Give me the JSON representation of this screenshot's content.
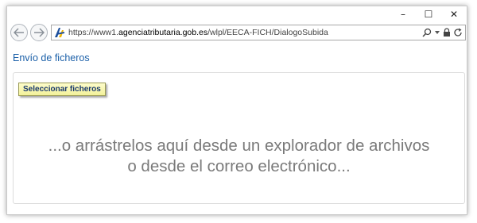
{
  "window": {
    "controls": {
      "minimize": "–",
      "maximize": "☐",
      "close": "✕"
    }
  },
  "addressbar": {
    "url_prefix": "https://www1.",
    "url_domain": "agenciatributaria.gob.es",
    "url_path": "/wlpl/EECA-FICH/DialogoSubida",
    "search_icon": "search-icon",
    "dropdown_icon": "chevron-down-icon",
    "lock_icon": "lock-icon",
    "refresh_icon": "refresh-icon"
  },
  "nav": {
    "back_icon": "back-arrow-icon",
    "forward_icon": "forward-arrow-icon"
  },
  "page": {
    "title": "Envío de ficheros",
    "select_button": "Seleccionar ficheros",
    "drop_line1": "...o arrástrelos aquí desde un explorador de archivos",
    "drop_line2": "o desde el correo electrónico..."
  },
  "colors": {
    "title": "#1a5fa8",
    "button_bg": "#f8f6b4",
    "button_text": "#1a3a6e",
    "drop_text": "#7a7a7a"
  }
}
